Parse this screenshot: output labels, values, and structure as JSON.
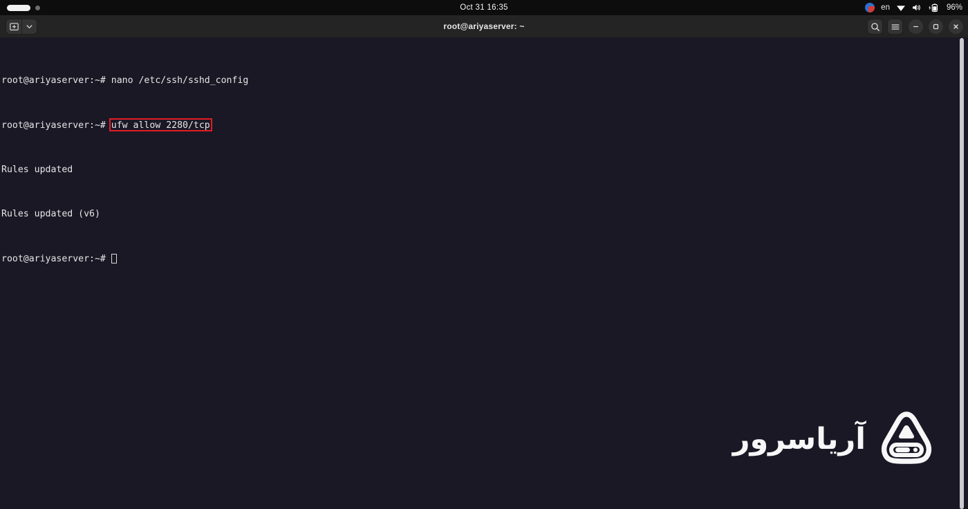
{
  "topbar": {
    "clock": "Oct 31  16:35",
    "language": "en",
    "battery_percent": "96%",
    "icons": {
      "activities": "activities-pill",
      "workspace": "workspace-dot",
      "app_indicator": "app-indicator-icon",
      "wifi": "wifi-icon",
      "volume": "volume-icon",
      "battery": "battery-charging-icon"
    }
  },
  "window": {
    "title": "root@ariyaserver: ~",
    "titlebar": {
      "new_tab_icon": "new-terminal-icon",
      "dropdown_icon": "chevron-down-icon",
      "search_icon": "search-icon",
      "menu_icon": "hamburger-menu-icon",
      "minimize_icon": "minimize-icon",
      "maximize_icon": "maximize-icon",
      "close_icon": "close-icon"
    }
  },
  "terminal": {
    "prompt": "root@ariyaserver:~# ",
    "lines": [
      {
        "prompt": "root@ariyaserver:~# ",
        "command": "nano /etc/ssh/sshd_config",
        "highlighted": false
      },
      {
        "prompt": "root@ariyaserver:~# ",
        "command": "ufw allow 2280/tcp",
        "highlighted": true
      },
      {
        "prompt": "",
        "command": "Rules updated",
        "highlighted": false
      },
      {
        "prompt": "",
        "command": "Rules updated (v6)",
        "highlighted": false
      },
      {
        "prompt": "root@ariyaserver:~# ",
        "command": "",
        "highlighted": false
      }
    ],
    "highlight_color": "#e31c23",
    "background_color": "#1b1826",
    "text_color": "#e6e6e6"
  },
  "watermark": {
    "brand_text": "آریاسرور",
    "logo_icon": "ariyaserver-logo-icon"
  }
}
